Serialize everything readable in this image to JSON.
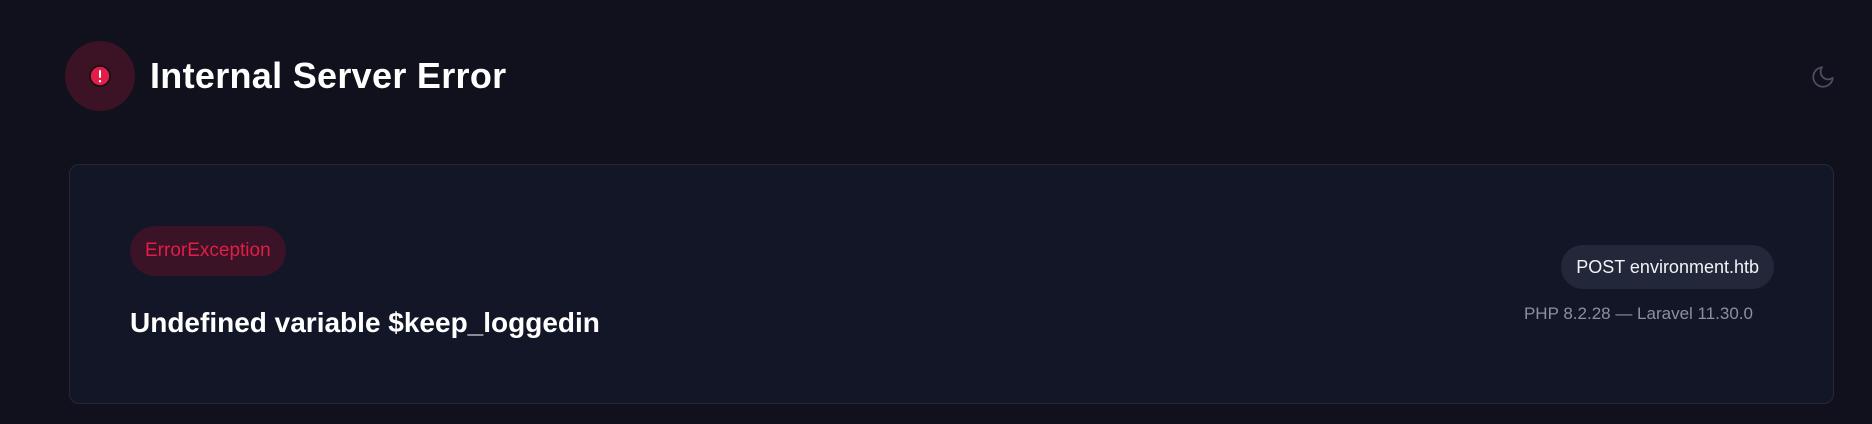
{
  "page": {
    "title": "Internal Server Error"
  },
  "icons": {
    "error": "exclamation-circle-icon",
    "theme_toggle": "moon-icon"
  },
  "exception": {
    "class": "ErrorException",
    "message": "Undefined variable $keep_loggedin"
  },
  "request": {
    "label": "POST environment.htb"
  },
  "environment": {
    "versions": "PHP 8.2.28 — Laravel 11.30.0"
  },
  "colors": {
    "background": "#10111d",
    "card": "#131627",
    "accent_red": "#e11d48",
    "badge_bg": "#3a1326"
  }
}
